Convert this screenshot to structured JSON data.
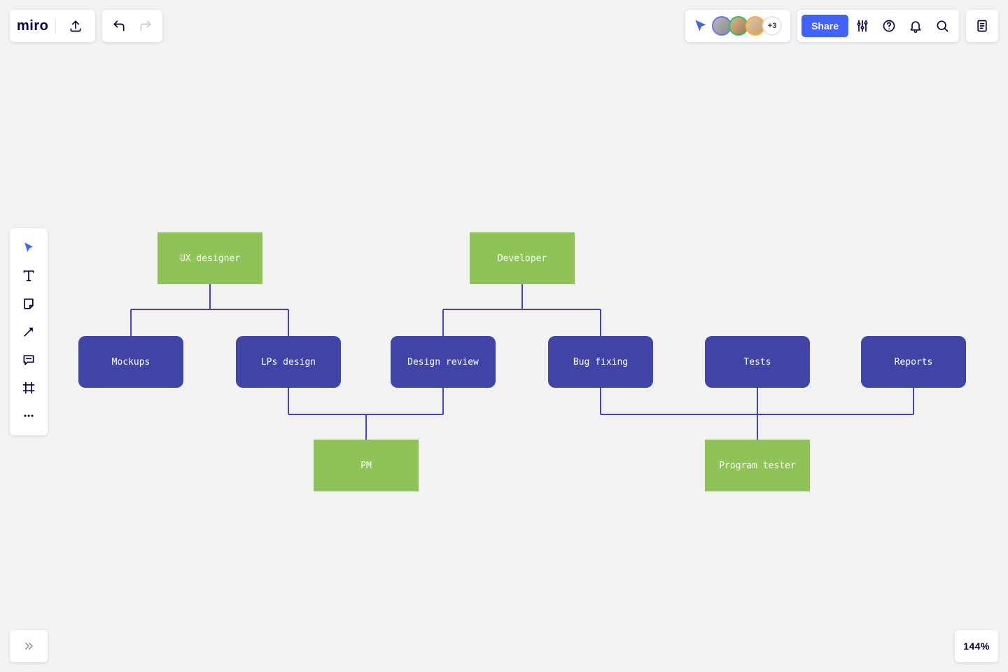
{
  "logo": "miro",
  "header": {
    "share_label": "Share",
    "more_avatars": "+3"
  },
  "zoom": "144%",
  "diagram": {
    "roles": {
      "ux": "UX designer",
      "dev": "Developer",
      "pm": "PM",
      "tester": "Program tester"
    },
    "tasks": {
      "mockups": "Mockups",
      "lps": "LPs design",
      "review": "Design review",
      "bug": "Bug fixing",
      "tests": "Tests",
      "reports": "Reports"
    }
  },
  "structure": {
    "UX designer": [
      "Mockups",
      "LPs design"
    ],
    "Developer": [
      "Design review",
      "Bug fixing"
    ],
    "PM": [
      "LPs design",
      "Design review"
    ],
    "Program tester": [
      "Bug fixing",
      "Tests",
      "Reports"
    ]
  },
  "colors": {
    "role_bg": "#8fc357",
    "task_bg": "#3f44a6",
    "connector": "#4242cc",
    "accent": "#4262ff"
  }
}
